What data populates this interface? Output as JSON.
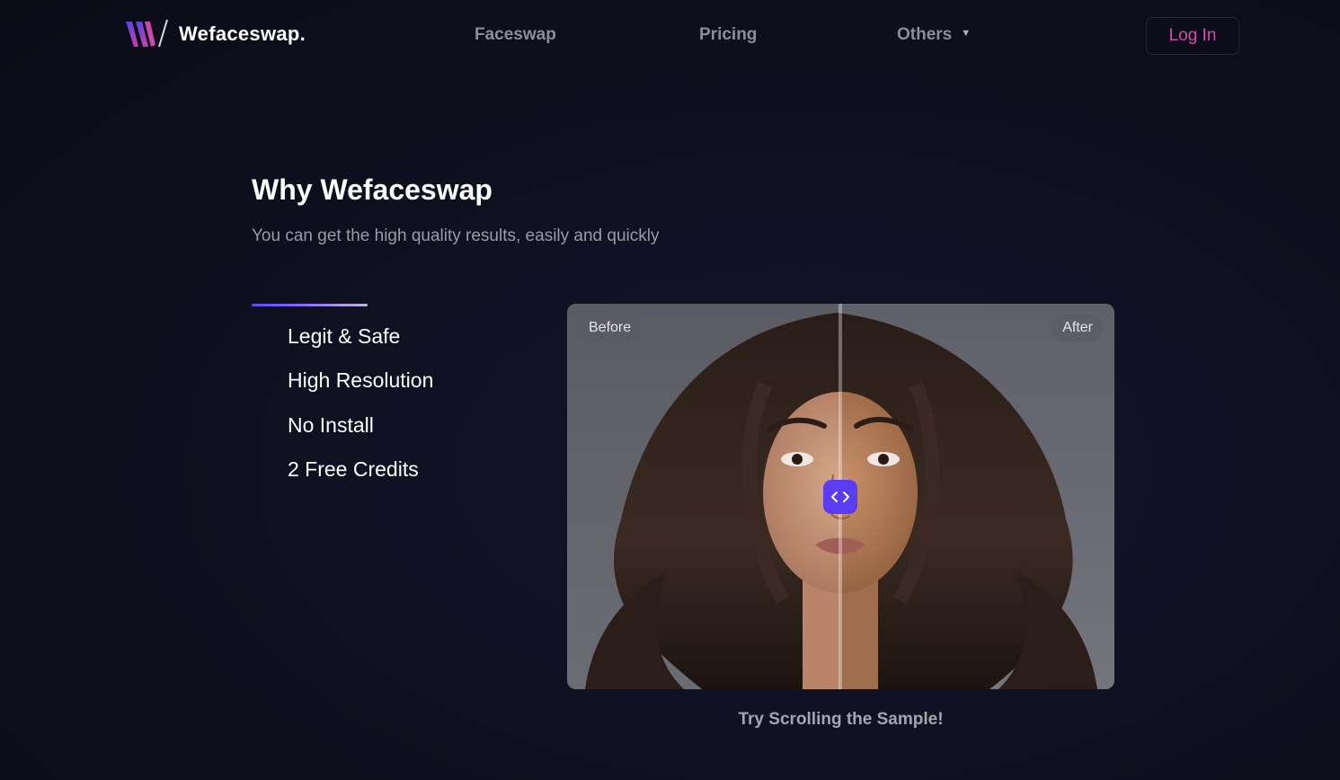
{
  "brand": {
    "name": "Wefaceswap.",
    "logo_icon": "w-logo-icon",
    "accent_pink": "#d64ab3",
    "accent_purple": "#5a3df2"
  },
  "nav": {
    "items": [
      {
        "label": "Faceswap"
      },
      {
        "label": "Pricing"
      },
      {
        "label": "Others",
        "icon": "chevron-down-icon"
      }
    ],
    "login_label": "Log In"
  },
  "section": {
    "title": "Why Wefaceswap",
    "subtitle": "You can get the high quality results, easily and quickly"
  },
  "features": [
    {
      "label": "Legit & Safe"
    },
    {
      "label": "High Resolution"
    },
    {
      "label": "No Install"
    },
    {
      "label": "2 Free Credits"
    }
  ],
  "comparison": {
    "before_label": "Before",
    "after_label": "After",
    "handle_icon": "code-arrows-icon",
    "slider_position": 0.5,
    "caption": "Try Scrolling the Sample!"
  }
}
